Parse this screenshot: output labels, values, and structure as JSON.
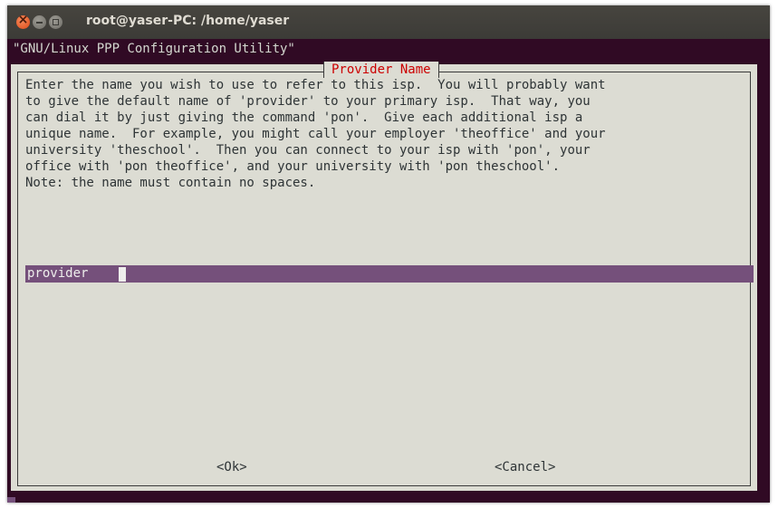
{
  "window": {
    "title": "root@yaser-PC: /home/yaser"
  },
  "terminal": {
    "backtitle": "\"GNU/Linux PPP Configuration Utility\"",
    "dialog": {
      "title": "Provider Name",
      "message": "Enter the name you wish to use to refer to this isp.  You will probably want\nto give the default name of 'provider' to your primary isp.  That way, you\ncan dial it by just giving the command 'pon'.  Give each additional isp a\nunique name.  For example, you might call your employer 'theoffice' and your\nuniversity 'theschool'.  Then you can connect to your isp with 'pon', your\noffice with 'pon theoffice', and your university with 'pon theschool'.\nNote: the name must contain no spaces.",
      "input_value": "provider",
      "ok_label": "<Ok>",
      "cancel_label": "<Cancel>"
    }
  },
  "colors": {
    "terminal_bg": "#300a24",
    "dialog_bg": "#dcdcd3",
    "title_red": "#cc0000",
    "input_purple": "#75507b"
  }
}
